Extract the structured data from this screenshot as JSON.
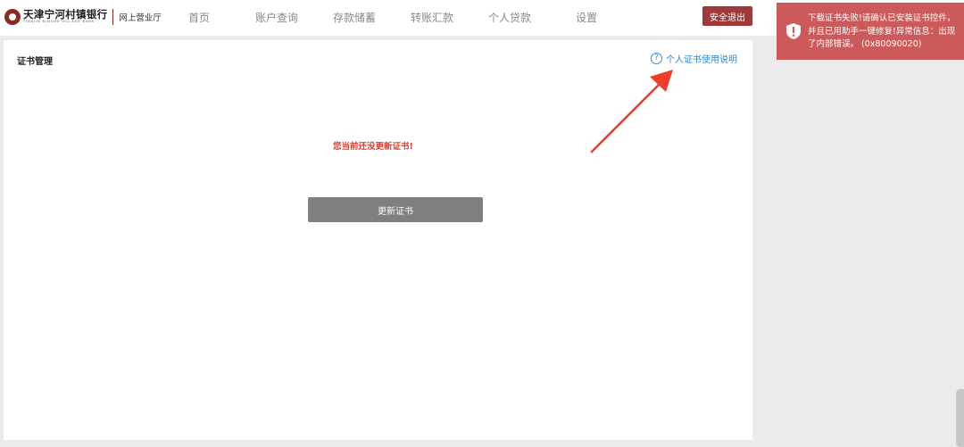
{
  "brand": {
    "name": "天津宁河村镇银行",
    "name_en": "TIANJIN NINGHE VILLAGE BANK",
    "subtitle": "网上营业厅",
    "color": "#8c2a22"
  },
  "nav": {
    "items": [
      {
        "label": "首页"
      },
      {
        "label": "账户查询"
      },
      {
        "label": "存款储蓄"
      },
      {
        "label": "转账汇款"
      },
      {
        "label": "个人贷款"
      },
      {
        "label": "设置"
      }
    ],
    "logout_label": "安全退出"
  },
  "panel": {
    "title": "证书管理",
    "help_icon": "question-circle-icon",
    "help_link": "个人证书使用说明",
    "notice": "您当前还没更新证书!",
    "update_button": "更新证书"
  },
  "toast": {
    "icon": "shield-exclamation-icon",
    "message": "下载证书失败!请确认已安装证书控件，并且已用助手一键修复!异常信息：出现了内部错误。 (0x80090020)",
    "color": "#cd5a5a"
  },
  "colors": {
    "accent_red": "#a03a3a",
    "link_blue": "#2f86c8",
    "notice_red": "#e33b2f",
    "button_gray": "#7f7f7f",
    "page_bg": "#ebebeb"
  }
}
